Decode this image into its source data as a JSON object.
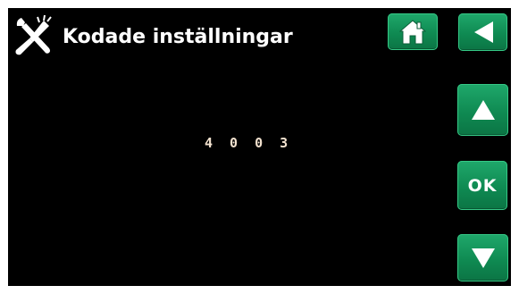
{
  "header": {
    "icon": "wrench-screwdriver-icon",
    "title": "Kodade inställningar"
  },
  "nav": {
    "home_icon": "home-icon",
    "back_icon": "back-arrow-icon"
  },
  "controls": {
    "up_icon": "arrow-up-icon",
    "ok_label": "OK",
    "down_icon": "arrow-down-icon"
  },
  "main": {
    "code_value": "4 0 0 3"
  },
  "colors": {
    "screen_background": "#000000",
    "button_green": "#0f8a52",
    "text_white": "#ffffff",
    "code_text": "#f3e2cf"
  }
}
